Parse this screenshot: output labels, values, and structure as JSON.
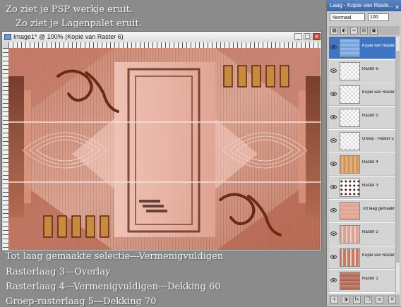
{
  "notes": {
    "psp_result": "Zo ziet je PSP werkje eruit.",
    "layers_result": "Zo ziet je Lagenpalet eruit."
  },
  "instructions": [
    "Tot laag gemaakte selectie---Vermenigvuldigen",
    "Rasterlaag 3---Overlay",
    "Rasterlaag 4---Vermenigvuldigen---Dekking 60",
    "Groep-rasterlaag 5---Dekking 70"
  ],
  "image_window": {
    "title": "Image1* @ 100% (Kopie van Raster 6)",
    "buttons": [
      "_",
      "□",
      "×"
    ]
  },
  "layers_palette": {
    "title": "Laag - Kopie van Raste...",
    "blend_mode": "Normaal",
    "opacity": "100",
    "layers": [
      {
        "name": "Kopie van Raster 6",
        "selected": true
      },
      {
        "name": "Raster 6",
        "selected": false
      },
      {
        "name": "Kopie van Raster 5",
        "selected": false
      },
      {
        "name": "Raster 5",
        "selected": false
      },
      {
        "name": "Groep - Raster 5",
        "selected": false
      },
      {
        "name": "Raster 4",
        "selected": false
      },
      {
        "name": "Raster 3",
        "selected": false
      },
      {
        "name": "Tot laag gemaakte s",
        "selected": false
      },
      {
        "name": "Raster 2",
        "selected": false
      },
      {
        "name": "Kopie van Raster 1",
        "selected": false
      },
      {
        "name": "Raster 1",
        "selected": false
      }
    ]
  },
  "colors": {
    "canvas_base": "#c98b79",
    "accent_dark": "#7a3a22",
    "palette_selection": "#3f75c2"
  }
}
